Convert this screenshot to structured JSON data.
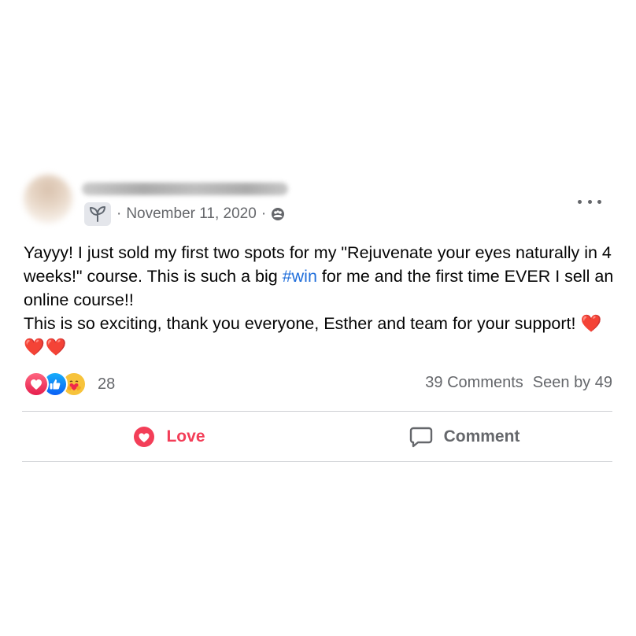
{
  "post": {
    "author_name": "Imeeu Alexandra Schelo",
    "date": "November 11, 2020",
    "separator": "·",
    "text_line1": "Yayyy! I just sold my first two spots for my \"Rejuvenate your eyes naturally in 4 weeks!\" course. This is such a big ",
    "hashtag": "#win",
    "text_line1_end": " for me and the first time EVER I sell an online course!!",
    "text_line2": "This is so exciting, thank you everyone, Esther and team for your support!",
    "hearts": "❤️❤️❤️"
  },
  "stats": {
    "reaction_count": "28",
    "comments": "39 Comments",
    "seen_by": "Seen by 49"
  },
  "actions": {
    "love_label": "Love",
    "comment_label": "Comment"
  },
  "colors": {
    "love": "#f33e58",
    "hashtag": "#216fdb",
    "muted": "#65676b"
  },
  "icons": [
    "seedling-icon",
    "members-icon",
    "more-options-icon",
    "love-reaction-icon",
    "like-reaction-icon",
    "care-reaction-icon",
    "heart-icon",
    "comment-icon"
  ]
}
